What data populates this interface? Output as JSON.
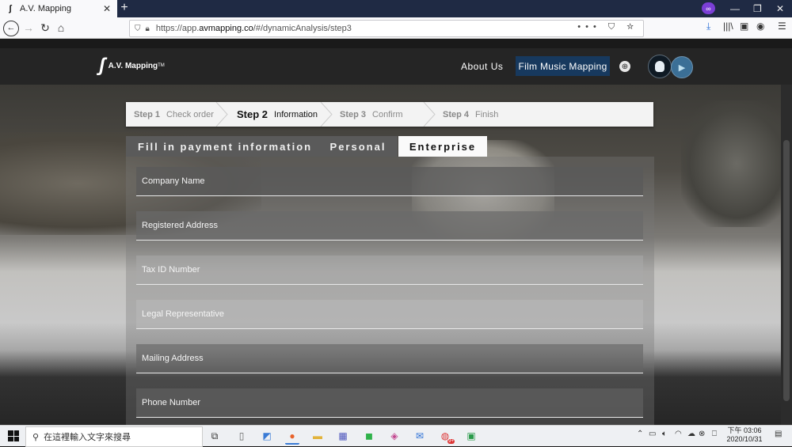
{
  "browser": {
    "tab_title": "A.V. Mapping",
    "tab_favicon": "av-logo-icon",
    "url_host": "https://app.",
    "url_domain": "avmapping.co",
    "url_path": "/#/dynamicAnalysis/step3",
    "url_actions": "•••"
  },
  "site": {
    "logo_name": "A.V. Mapping",
    "logo_tm": "TM",
    "nav_about": "About Us",
    "nav_fmm": "Film Music Mapping"
  },
  "steps": [
    {
      "num": "Step 1",
      "label": "Check order",
      "active": false
    },
    {
      "num": "Step 2",
      "label": "Information",
      "active": true
    },
    {
      "num": "Step 3",
      "label": "Confirm",
      "active": false
    },
    {
      "num": "Step 4",
      "label": "Finish",
      "active": false
    }
  ],
  "payment": {
    "title": "Fill in payment information",
    "tabs": [
      "Personal",
      "Enterprise"
    ],
    "selected_tab": "Enterprise"
  },
  "form": {
    "fields": [
      "Company Name",
      "Registered Address",
      "Tax ID Number",
      "Legal Representative",
      "Mailing Address",
      "Phone Number"
    ]
  },
  "taskbar": {
    "search_placeholder": "在這裡輸入文字來搜尋",
    "time": "下午 03:06",
    "date": "2020/10/31",
    "mail_badge": "9+"
  },
  "colors": {
    "header_bg": "#252525",
    "fmm_button": "#17395e",
    "browser_titlebar": "#1f2a44"
  }
}
